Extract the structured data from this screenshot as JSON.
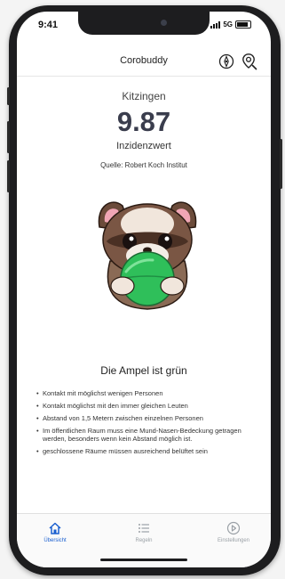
{
  "status": {
    "time": "9:41",
    "network": "5G"
  },
  "app": {
    "title": "Corobuddy"
  },
  "incidence": {
    "city": "Kitzingen",
    "value": "9.87",
    "label": "Inzidenzwert",
    "source": "Quelle: Robert Koch Institut"
  },
  "traffic_light": {
    "headline": "Die Ampel ist grün",
    "rules": [
      "Kontakt mit möglichst wenigen Personen",
      "Kontakt möglichst mit den immer gleichen Leuten",
      "Abstand von 1,5 Metern zwischen einzelnen Personen",
      "Im öffentlichen Raum muss eine Mund-Nasen-Bedeckung getragen werden, besonders wenn kein Abstand möglich ist.",
      "geschlossene Räume müssen ausreichend belüftet sein"
    ]
  },
  "tabs": [
    {
      "label": "Übersicht",
      "icon": "home-icon",
      "active": true
    },
    {
      "label": "Regeln",
      "icon": "list-icon",
      "active": false
    },
    {
      "label": "Einstellungen",
      "icon": "settings-icon",
      "active": false
    }
  ],
  "colors": {
    "accent": "#1a5fd0",
    "ball": "#2fbf5a",
    "value_text": "#3a3d4d"
  }
}
